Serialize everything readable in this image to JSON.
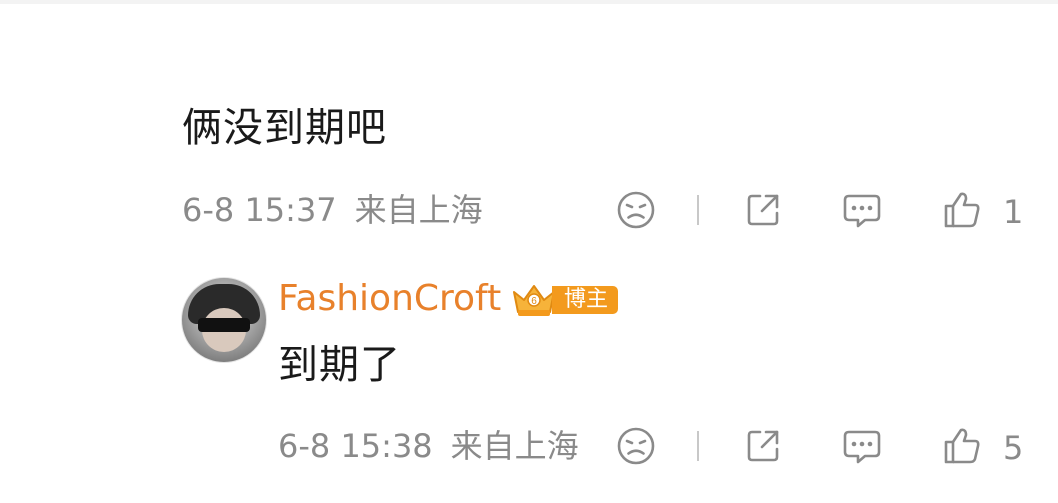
{
  "comments": [
    {
      "text": "俩没到期吧",
      "date": "6-8 15:37",
      "location": "来自上海",
      "like_count": "1"
    },
    {
      "username": "FashionCroft",
      "badge_label": "博主",
      "text": "到期了",
      "date": "6-8 15:38",
      "location": "来自上海",
      "like_count": "5"
    }
  ],
  "icons": {
    "dislike": "sad-face-icon",
    "share": "share-icon",
    "reply": "comment-bubble-icon",
    "like": "thumbs-up-icon"
  },
  "colors": {
    "text": "#1a1a1a",
    "meta": "#8a8a8a",
    "username": "#e8812b",
    "badge": "#f39a1d"
  }
}
